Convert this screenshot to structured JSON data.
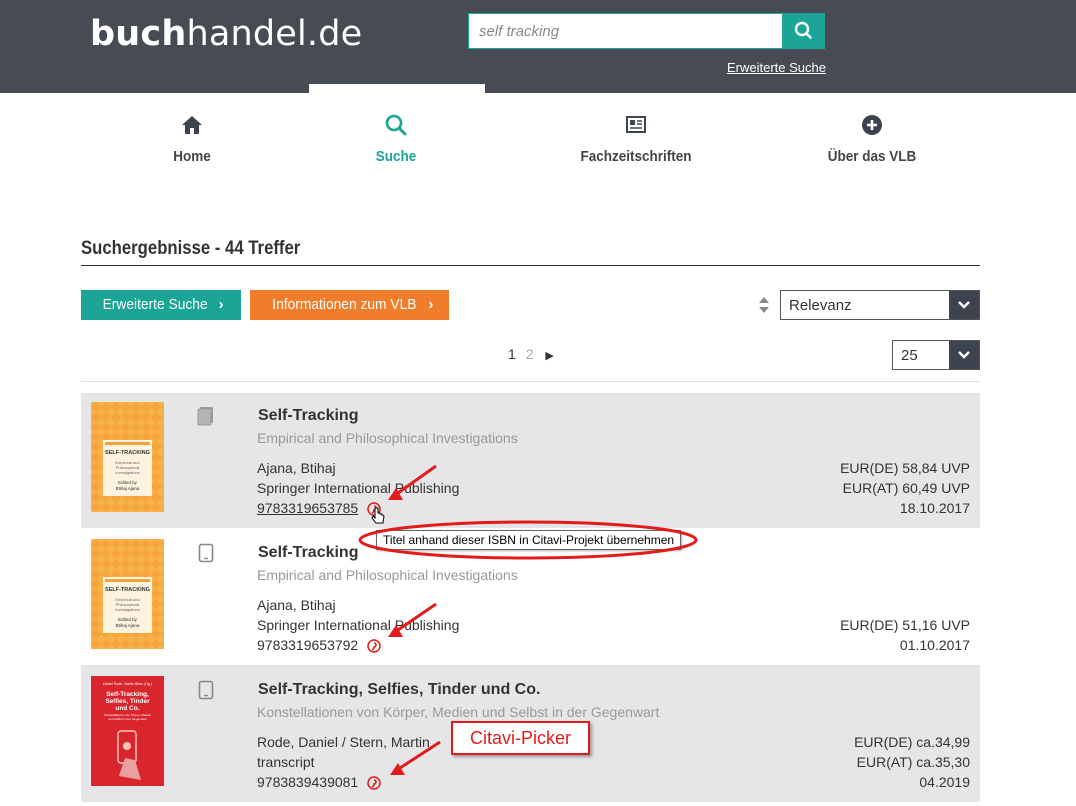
{
  "header": {
    "logo_bold": "buch",
    "logo_rest": "handel.de",
    "search_value": "self tracking",
    "advanced_search_link": "Erweiterte Suche"
  },
  "nav": [
    {
      "label": "Home",
      "icon": "home-icon"
    },
    {
      "label": "Suche",
      "icon": "search-icon",
      "active": true
    },
    {
      "label": "Fachzeitschriften",
      "icon": "newspaper-icon"
    },
    {
      "label": "Über das VLB",
      "icon": "plus-circle-icon"
    }
  ],
  "results": {
    "title": "Suchergebnisse - 44 Treffer",
    "btn_advanced": "Erweiterte Suche",
    "btn_info": "Informationen zum VLB",
    "sort_value": "Relevanz",
    "per_page_value": "25",
    "pages": [
      "1",
      "2"
    ],
    "current_page": "1"
  },
  "items": [
    {
      "title": "Self-Tracking",
      "subtitle": "Empirical and Philosophical Investigations",
      "author": "Ajana, Btihaj",
      "publisher": "Springer International Publishing",
      "isbn": "9783319653785",
      "prices": [
        "EUR(DE) 58,84 UVP",
        "EUR(AT) 60,49 UVP",
        "18.10.2017"
      ],
      "format_icon": "book-icon",
      "cover": {
        "top_label": "SELF-TRACKING",
        "lines": [
          "Empirical and",
          "Philosophical",
          "Investigations"
        ],
        "editor": "Edited by",
        "editor_name": "Btihaj Ajana"
      }
    },
    {
      "title": "Self-Tracking",
      "subtitle": "Empirical and Philosophical Investigations",
      "author": "Ajana, Btihaj",
      "publisher": "Springer International Publishing",
      "isbn": "9783319653792",
      "prices": [
        "EUR(DE) 51,16 UVP",
        "01.10.2017"
      ],
      "format_icon": "ebook-icon",
      "cover": {
        "top_label": "SELF-TRACKING",
        "lines": [
          "Empirical and",
          "Philosophical",
          "Investigations"
        ],
        "editor": "Edited by",
        "editor_name": "Btihaj Ajana"
      }
    },
    {
      "title": "Self-Tracking, Selfies, Tinder und Co.",
      "subtitle": "Konstellationen von Körper, Medien und Selbst in der Gegenwart",
      "author": "Rode, Daniel / Stern, Martin",
      "publisher": "transcript",
      "isbn": "9783839439081",
      "prices": [
        "EUR(DE) ca.34,99",
        "EUR(AT) ca.35,30",
        "04.2019"
      ],
      "format_icon": "ebook-icon",
      "cover": {
        "top_label": "Daniel Rode, Martin Stern (Hg.)",
        "lines": [
          "Self-Tracking,",
          "Selfies, Tinder",
          "und Co."
        ],
        "editor": "Konstellationen von Körper, Medien",
        "editor_name": "und Selbst in der Gegenwart"
      }
    }
  ],
  "tooltip": "Titel anhand dieser ISBN in Citavi-Projekt übernehmen",
  "annotation_label": "Citavi-Picker",
  "colors": {
    "header": "#464b54",
    "teal": "#1aa596",
    "orange": "#ef7d2b",
    "annotation_red": "#e31b1b",
    "row_gray": "#e6e6e8"
  }
}
